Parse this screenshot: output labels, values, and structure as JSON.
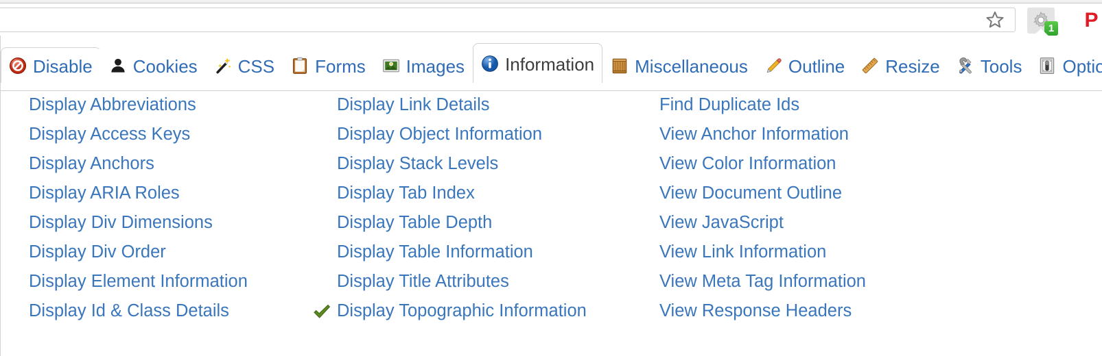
{
  "browser": {
    "omnibox": {
      "value": "",
      "placeholder": ""
    },
    "star_icon": "star-bookmark-icon",
    "extension_button": {
      "icon": "gear-icon",
      "badge": "1"
    },
    "extension_button_2": {
      "icon": "pdf-icon",
      "label": "P"
    }
  },
  "colors": {
    "link": "#3a76bc",
    "tab_label": "#2f6cb5",
    "tab_active_label": "#3c3c3c",
    "badge_green": "#3ebd3e",
    "check_green": "#5c8a22",
    "panel_border": "#cfcfcf"
  },
  "toolbar": {
    "tabs": [
      {
        "label": "Disable",
        "icon": "no-entry-icon",
        "active": false
      },
      {
        "label": "Cookies",
        "icon": "person-icon",
        "active": false
      },
      {
        "label": "CSS",
        "icon": "magic-wand-icon",
        "active": false
      },
      {
        "label": "Forms",
        "icon": "clipboard-icon",
        "active": false
      },
      {
        "label": "Images",
        "icon": "picture-icon",
        "active": false
      },
      {
        "label": "Information",
        "icon": "info-circle-icon",
        "active": true
      },
      {
        "label": "Miscellaneous",
        "icon": "crate-box-icon",
        "active": false
      },
      {
        "label": "Outline",
        "icon": "pencil-icon",
        "active": false
      },
      {
        "label": "Resize",
        "icon": "ruler-icon",
        "active": false
      },
      {
        "label": "Tools",
        "icon": "wrench-screwdriver-icon",
        "active": false
      },
      {
        "label": "Options",
        "icon": "toggle-switch-icon",
        "active": false
      }
    ]
  },
  "menu": {
    "columns": [
      {
        "items": [
          {
            "label": "Display Abbreviations",
            "checked": false
          },
          {
            "label": "Display Access Keys",
            "checked": false
          },
          {
            "label": "Display Anchors",
            "checked": false
          },
          {
            "label": "Display ARIA Roles",
            "checked": false
          },
          {
            "label": "Display Div Dimensions",
            "checked": false
          },
          {
            "label": "Display Div Order",
            "checked": false
          },
          {
            "label": "Display Element Information",
            "checked": false
          },
          {
            "label": "Display Id & Class Details",
            "checked": false
          }
        ]
      },
      {
        "items": [
          {
            "label": "Display Link Details",
            "checked": false
          },
          {
            "label": "Display Object Information",
            "checked": false
          },
          {
            "label": "Display Stack Levels",
            "checked": false
          },
          {
            "label": "Display Tab Index",
            "checked": false
          },
          {
            "label": "Display Table Depth",
            "checked": false
          },
          {
            "label": "Display Table Information",
            "checked": false
          },
          {
            "label": "Display Title Attributes",
            "checked": false
          },
          {
            "label": "Display Topographic Information",
            "checked": true
          }
        ]
      },
      {
        "items": [
          {
            "label": "Find Duplicate Ids",
            "checked": false
          },
          {
            "label": "View Anchor Information",
            "checked": false
          },
          {
            "label": "View Color Information",
            "checked": false
          },
          {
            "label": "View Document Outline",
            "checked": false
          },
          {
            "label": "View JavaScript",
            "checked": false
          },
          {
            "label": "View Link Information",
            "checked": false
          },
          {
            "label": "View Meta Tag Information",
            "checked": false
          },
          {
            "label": "View Response Headers",
            "checked": false
          }
        ]
      }
    ]
  }
}
